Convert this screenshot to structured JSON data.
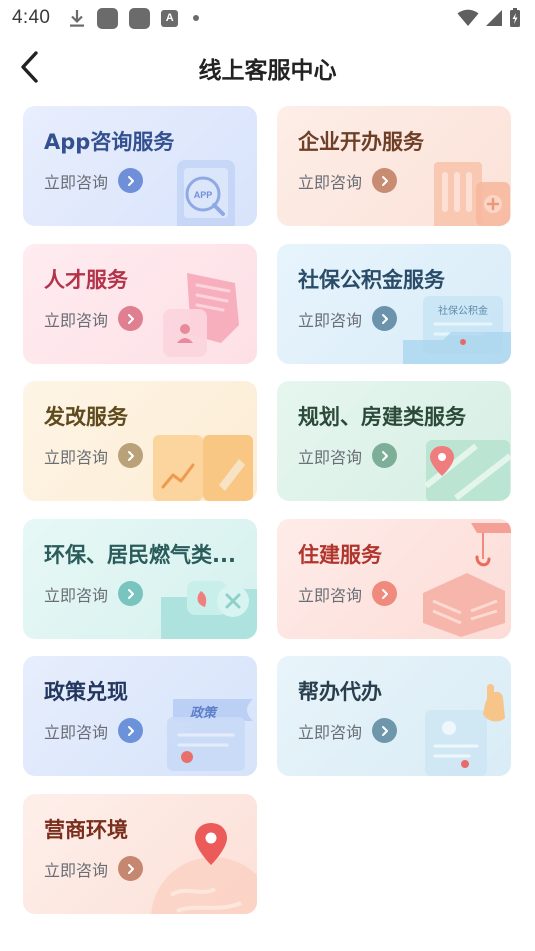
{
  "status_bar": {
    "time": "4:40",
    "left_icons": [
      "download-icon",
      "app-notification-icon",
      "app-notification-icon",
      "text-a-icon",
      "more-dot-icon"
    ],
    "right_icons": [
      "wifi-icon",
      "signal-icon",
      "battery-icon"
    ]
  },
  "header": {
    "title": "线上客服中心",
    "back_icon": "chevron-left-icon"
  },
  "cards": [
    {
      "title": "App咨询服务",
      "action": "立即咨询",
      "title_color": "#34508e",
      "bg": "#dfe8fc",
      "arrow_color": "#6f8fd8",
      "icon": "app-search-icon",
      "illus_text": "APP"
    },
    {
      "title": "企业开办服务",
      "action": "立即咨询",
      "title_color": "#6e3f26",
      "bg": "#fde9e1",
      "arrow_color": "#c88c72",
      "icon": "building-plus-icon"
    },
    {
      "title": "人才服务",
      "action": "立即咨询",
      "title_color": "#b3334a",
      "bg": "#fde6ea",
      "arrow_color": "#e07f91",
      "icon": "person-card-icon"
    },
    {
      "title": "社保公积金服务",
      "action": "立即咨询",
      "title_color": "#2a4c68",
      "bg": "#e1f1fb",
      "arrow_color": "#6c93ac",
      "icon": "social-security-folder-icon",
      "illus_text": "社保公积金"
    },
    {
      "title": "发改服务",
      "action": "立即咨询",
      "title_color": "#5f4a1c",
      "bg": "#fdf1dc",
      "arrow_color": "#b9a27a",
      "icon": "chart-book-icon"
    },
    {
      "title": "规划、房建类服务",
      "action": "立即咨询",
      "title_color": "#2c4a3a",
      "bg": "#e0f4ec",
      "arrow_color": "#7daf98",
      "icon": "map-pin-icon"
    },
    {
      "title": "环保、居民燃气类...",
      "action": "立即咨询",
      "title_color": "#2a5c5c",
      "bg": "#dff5f3",
      "arrow_color": "#79c4bf",
      "icon": "eco-folder-icon"
    },
    {
      "title": "住建服务",
      "action": "立即咨询",
      "title_color": "#b0352c",
      "bg": "#fde5e2",
      "arrow_color": "#ef8a7d",
      "icon": "crane-building-icon"
    },
    {
      "title": "政策兑现",
      "action": "立即咨询",
      "title_color": "#23365e",
      "bg": "#dfeafc",
      "arrow_color": "#6c93da",
      "icon": "policy-scroll-icon",
      "illus_text": "政策"
    },
    {
      "title": "帮办代办",
      "action": "立即咨询",
      "title_color": "#2a3f4e",
      "bg": "#e3f1f8",
      "arrow_color": "#6f97ab",
      "icon": "helping-hand-doc-icon"
    },
    {
      "title": "营商环境",
      "action": "立即咨询",
      "title_color": "#7a2e1c",
      "bg": "#fde7df",
      "arrow_color": "#c5876f",
      "icon": "globe-location-icon"
    }
  ]
}
